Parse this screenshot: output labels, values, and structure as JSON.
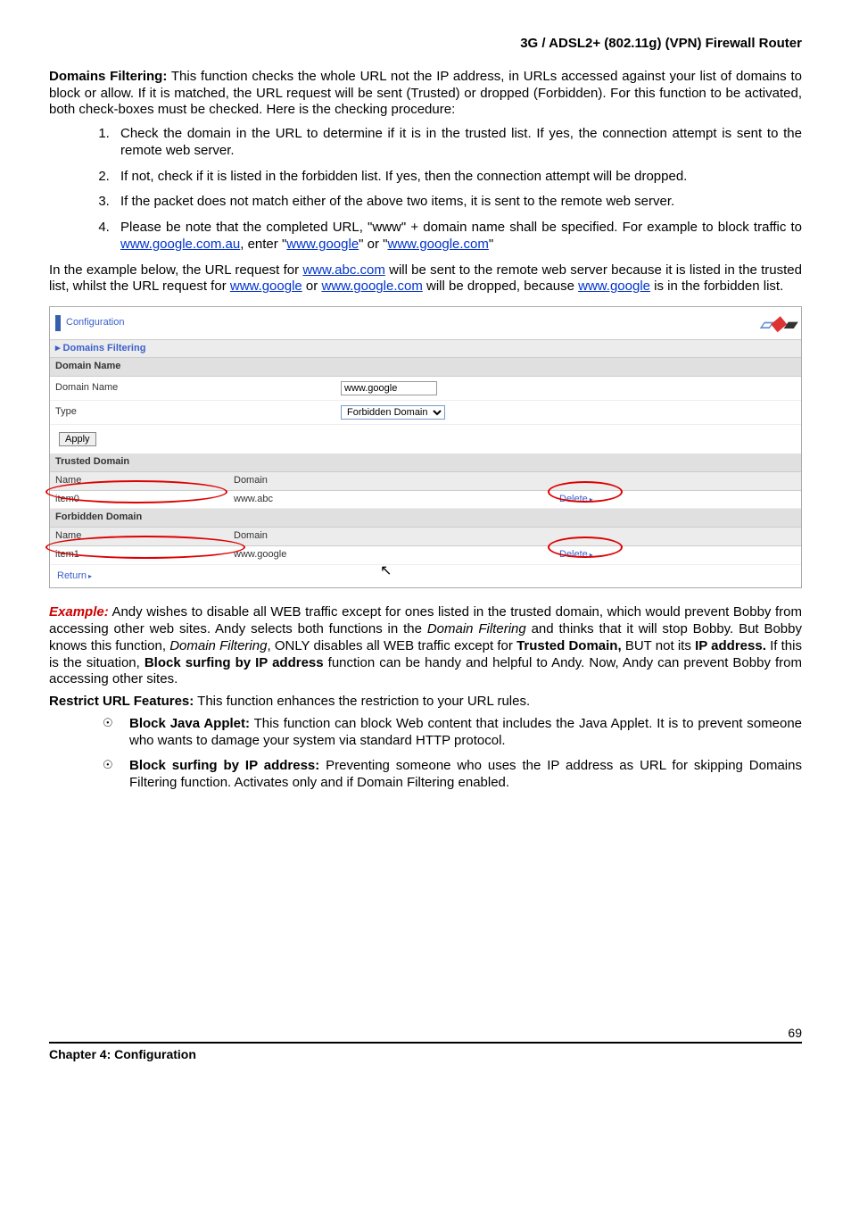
{
  "header": {
    "title": "3G / ADSL2+ (802.11g) (VPN) Firewall Router"
  },
  "intro": {
    "heading": "Domains Filtering:",
    "body": " This function checks the whole URL not the IP address, in URLs accessed against your list of domains to block or allow.   If it is matched, the URL request will be sent (Trusted) or dropped (Forbidden).   For this function to be activated, both check-boxes must be checked.   Here is the checking procedure:"
  },
  "procedure": [
    "Check the domain in the URL to determine if it is in the trusted list. If yes, the connection attempt is sent to the remote web server.",
    "If not, check if it is listed in the forbidden list.   If yes, then the connection attempt will be dropped.",
    "If the packet does not match either of the above two items, it is sent to the remote web server."
  ],
  "procedure4": {
    "pre": "Please be note that the completed URL, \"www\" + domain name shall be specified. For example to block traffic to ",
    "link1": "www.google.com.au",
    "mid": ", enter \"",
    "link2": "www.google",
    "mid2": "\" or \"",
    "link3": "www.google.com",
    "end": "\""
  },
  "example_intro": {
    "pre": "In the example below, the URL request for ",
    "link1": "www.abc.com",
    "mid1": " will be sent to the remote web server because it is listed in the trusted list, whilst the URL request for ",
    "link2": "www.google",
    "mid2": " or ",
    "link3": "www.google.com",
    "mid3": " will be dropped, because ",
    "link4": "www.google",
    "end": " is in the forbidden list."
  },
  "screenshot": {
    "configuration": "Configuration",
    "section": "Domains Filtering",
    "domain_name_header": "Domain Name",
    "domain_name_label": "Domain Name",
    "domain_name_value": "www.google",
    "type_label": "Type",
    "type_value": "Forbidden Domain",
    "apply": "Apply",
    "trusted_header": "Trusted Domain",
    "col_name": "Name",
    "col_domain": "Domain",
    "trusted_item_name": "item0",
    "trusted_item_domain": "www.abc",
    "delete": "Delete",
    "forbidden_header": "Forbidden Domain",
    "forbidden_item_name": "item1",
    "forbidden_item_domain": "www.google",
    "return": "Return"
  },
  "example": {
    "heading": "Example:",
    "p1a": "   Andy wishes to disable all WEB traffic except for ones listed in the trusted domain, which would prevent Bobby from accessing other web sites.   Andy selects both functions in the ",
    "em1": "Domain Filtering",
    "p1b": " and thinks that it will stop Bobby.   But Bobby knows this function, ",
    "em2": "Domain Filtering",
    "p1c": ", ONLY disables all WEB traffic except for ",
    "b1": "Trusted Domain,",
    "p1d": " BUT not its ",
    "b2": "IP address.",
    "p1e": "   If this is the situation, ",
    "b3": "Block surfing by IP address",
    "p1f": " function can be handy and helpful to Andy.    Now, Andy can prevent Bobby from accessing other sites."
  },
  "restrict": {
    "heading": "Restrict URL Features:",
    "body": " This function enhances the restriction to your URL rules.",
    "b1_h": "Block Java Applet:",
    "b1_b": " This function can block Web content that includes the Java Applet. It is to prevent someone who wants to damage your system via standard HTTP protocol.",
    "b2_h": "Block surfing by IP address:",
    "b2_b": " Preventing someone who uses the IP address as URL for skipping Domains Filtering function.    Activates only and if Domain Filtering enabled."
  },
  "footer": {
    "chapter": "Chapter 4: Configuration",
    "page": "69"
  }
}
